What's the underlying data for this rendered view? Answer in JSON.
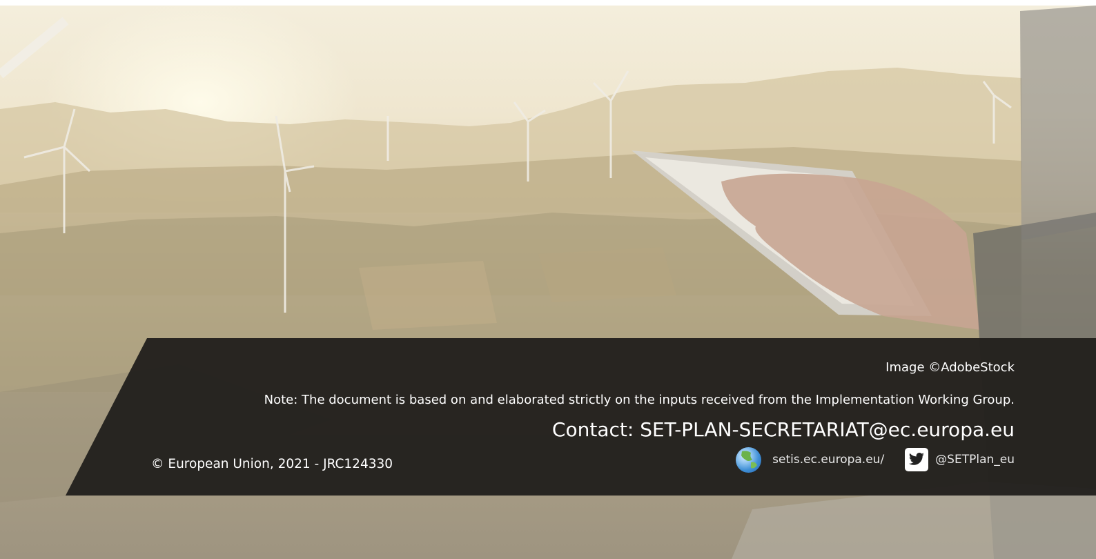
{
  "footer": {
    "image_credit": "Image ©AdobeStock",
    "note": "Note: The document is based on and elaborated strictly on the inputs received from the Implementation Working Group.",
    "contact": "Contact: SET-PLAN-SECRETARIAT@ec.europa.eu",
    "copyright": "© European Union, 2021 - JRC124330",
    "website": "setis.ec.europa.eu/",
    "twitter": "@SETPlan_eu"
  },
  "colors": {
    "banner": "#23211e",
    "text": "#ffffff"
  },
  "icons": [
    "globe-icon",
    "twitter-icon"
  ]
}
